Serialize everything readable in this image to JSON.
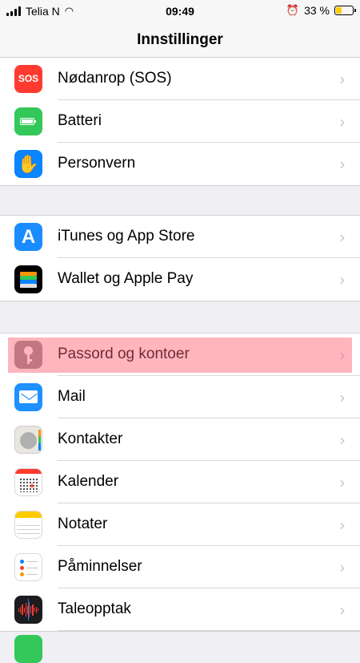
{
  "status_bar": {
    "carrier": "Telia N",
    "time": "09:49",
    "battery_percent": "33 %",
    "battery_level": 0.33
  },
  "nav": {
    "title": "Innstillinger"
  },
  "groups": [
    {
      "items": [
        {
          "label": "Nødanrop (SOS)",
          "icon": "sos-icon",
          "icon_text": "SOS",
          "color": "#ff3b30"
        },
        {
          "label": "Batteri",
          "icon": "battery-icon",
          "color": "#34c759"
        },
        {
          "label": "Personvern",
          "icon": "hand-icon",
          "color": "#0a84ff"
        }
      ]
    },
    {
      "items": [
        {
          "label": "iTunes og App Store",
          "icon": "app-store-icon",
          "color": "#1a8cff"
        },
        {
          "label": "Wallet og Apple Pay",
          "icon": "wallet-icon",
          "color": "#000000"
        }
      ]
    },
    {
      "items": [
        {
          "label": "Passord og kontoer",
          "icon": "key-icon",
          "color": "#8e8e93",
          "highlighted": true
        },
        {
          "label": "Mail",
          "icon": "mail-icon",
          "color": "#1e90ff"
        },
        {
          "label": "Kontakter",
          "icon": "contacts-icon",
          "color": "#e9e6e1"
        },
        {
          "label": "Kalender",
          "icon": "calendar-icon",
          "color": "#ff3b30"
        },
        {
          "label": "Notater",
          "icon": "notes-icon",
          "color": "#ffcc00"
        },
        {
          "label": "Påminnelser",
          "icon": "reminders-icon",
          "color": "#ffffff"
        },
        {
          "label": "Taleopptak",
          "icon": "voice-memos-icon",
          "color": "#1c1c1e"
        }
      ]
    }
  ],
  "chevron": "›"
}
